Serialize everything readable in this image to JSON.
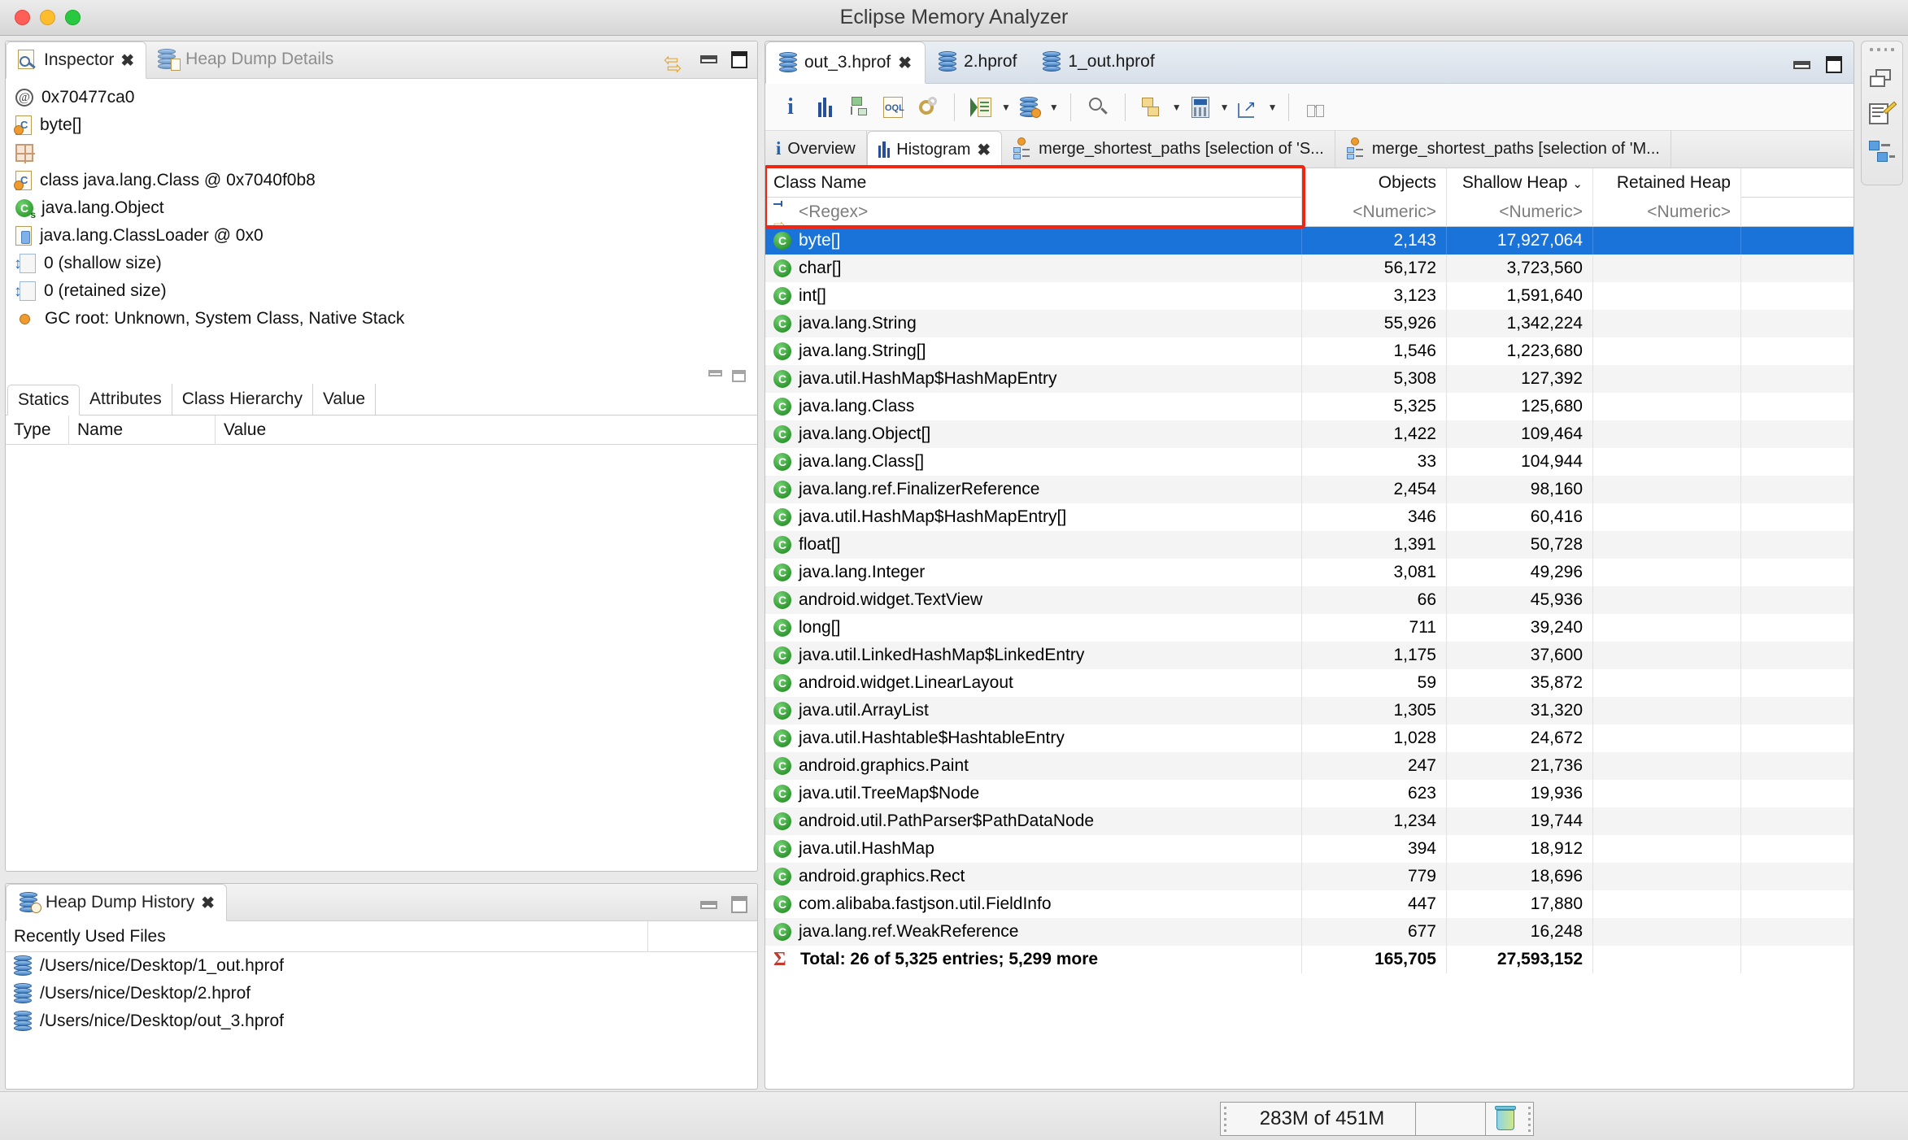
{
  "window": {
    "title": "Eclipse Memory Analyzer",
    "traffic_lights": [
      "close-red",
      "minimize-yellow",
      "zoom-green"
    ]
  },
  "inspector": {
    "tabs": [
      {
        "label": "Inspector",
        "icon": "inspector-icon",
        "active": true,
        "closable": true
      },
      {
        "label": "Heap Dump Details",
        "icon": "heap-dump-details-icon",
        "active": false,
        "closable": false
      }
    ],
    "tools": [
      "link-with-editor-icon",
      "minimize-icon",
      "maximize-icon"
    ],
    "rows": [
      {
        "icon": "address-at-icon",
        "text": "0x70477ca0"
      },
      {
        "icon": "class-doc-icon",
        "text": "byte[]"
      },
      {
        "icon": "grid-icon",
        "text": ""
      },
      {
        "icon": "class-doc-icon",
        "text": "class java.lang.Class @ 0x7040f0b8"
      },
      {
        "icon": "superclass-icon",
        "text": "java.lang.Object"
      },
      {
        "icon": "classloader-icon",
        "text": "java.lang.ClassLoader @ 0x0"
      },
      {
        "icon": "shallow-size-icon",
        "text": "0 (shallow size)"
      },
      {
        "icon": "retained-size-icon",
        "text": "0 (retained size)"
      },
      {
        "icon": "gc-root-icon",
        "text": "GC root: Unknown, System Class, Native Stack"
      }
    ],
    "sub_tabs": [
      {
        "label": "Statics",
        "active": true
      },
      {
        "label": "Attributes",
        "active": false
      },
      {
        "label": "Class Hierarchy",
        "active": false
      },
      {
        "label": "Value",
        "active": false
      }
    ],
    "detail_columns": [
      "Type",
      "Name",
      "Value"
    ],
    "detail_rows": []
  },
  "heap_dump_history": {
    "tab": {
      "label": "Heap Dump History",
      "icon": "heap-dump-history-icon",
      "closable": true
    },
    "tools": [
      "minimize-icon",
      "maximize-icon"
    ],
    "column_header": "Recently Used Files",
    "files": [
      "/Users/nice/Desktop/1_out.hprof",
      "/Users/nice/Desktop/2.hprof",
      "/Users/nice/Desktop/out_3.hprof"
    ]
  },
  "editor": {
    "tabs": [
      {
        "label": "out_3.hprof",
        "active": true,
        "closable": true
      },
      {
        "label": "2.hprof",
        "active": false,
        "closable": false
      },
      {
        "label": "1_out.hprof",
        "active": false,
        "closable": false
      }
    ],
    "tools": [
      "minimize-icon",
      "maximize-icon"
    ],
    "toolbar": [
      {
        "name": "overview-info-icon",
        "glyph": "i"
      },
      {
        "name": "histogram-icon",
        "glyph": "bars"
      },
      {
        "name": "dominator-tree-icon",
        "glyph": "tree"
      },
      {
        "name": "oql-icon",
        "glyph": "OQL"
      },
      {
        "name": "run-expert-system-icon",
        "glyph": "gears"
      },
      {
        "name": "open-query-browser-icon",
        "glyph": "query",
        "dropdown": true
      },
      {
        "name": "inspect-icon",
        "glyph": "inspect",
        "dropdown": true
      },
      {
        "name": "find-icon",
        "glyph": "magnifier"
      },
      {
        "name": "group-by-icon",
        "glyph": "group",
        "dropdown": true
      },
      {
        "name": "calculator-icon",
        "glyph": "calc",
        "dropdown": true
      },
      {
        "name": "export-icon",
        "glyph": "export",
        "dropdown": true
      },
      {
        "name": "compare-icon",
        "glyph": "compare"
      }
    ],
    "inner_tabs": [
      {
        "label": "Overview",
        "icon": "info-icon",
        "active": false,
        "closable": false
      },
      {
        "label": "Histogram",
        "icon": "histogram-icon",
        "active": true,
        "closable": true
      },
      {
        "label": "merge_shortest_paths [selection of 'S...",
        "icon": "paths-icon",
        "active": false,
        "closable": false
      },
      {
        "label": "merge_shortest_paths [selection of 'M...",
        "icon": "paths-icon",
        "active": false,
        "closable": false
      }
    ]
  },
  "histogram": {
    "columns": [
      {
        "label": "Class Name",
        "align": "left"
      },
      {
        "label": "Objects",
        "align": "right"
      },
      {
        "label": "Shallow Heap",
        "align": "right",
        "sorted": "desc",
        "sort_glyph": "⌄"
      },
      {
        "label": "Retained Heap",
        "align": "right"
      }
    ],
    "filter_row": {
      "class_name": "<Regex>",
      "objects": "<Numeric>",
      "shallow_heap": "<Numeric>",
      "retained_heap": "<Numeric>"
    },
    "rows": [
      {
        "class_name": "byte[]",
        "objects": "2,143",
        "shallow_heap": "17,927,064",
        "retained_heap": "",
        "selected": true
      },
      {
        "class_name": "char[]",
        "objects": "56,172",
        "shallow_heap": "3,723,560",
        "retained_heap": ""
      },
      {
        "class_name": "int[]",
        "objects": "3,123",
        "shallow_heap": "1,591,640",
        "retained_heap": ""
      },
      {
        "class_name": "java.lang.String",
        "objects": "55,926",
        "shallow_heap": "1,342,224",
        "retained_heap": ""
      },
      {
        "class_name": "java.lang.String[]",
        "objects": "1,546",
        "shallow_heap": "1,223,680",
        "retained_heap": ""
      },
      {
        "class_name": "java.util.HashMap$HashMapEntry",
        "objects": "5,308",
        "shallow_heap": "127,392",
        "retained_heap": ""
      },
      {
        "class_name": "java.lang.Class",
        "objects": "5,325",
        "shallow_heap": "125,680",
        "retained_heap": ""
      },
      {
        "class_name": "java.lang.Object[]",
        "objects": "1,422",
        "shallow_heap": "109,464",
        "retained_heap": ""
      },
      {
        "class_name": "java.lang.Class[]",
        "objects": "33",
        "shallow_heap": "104,944",
        "retained_heap": ""
      },
      {
        "class_name": "java.lang.ref.FinalizerReference",
        "objects": "2,454",
        "shallow_heap": "98,160",
        "retained_heap": ""
      },
      {
        "class_name": "java.util.HashMap$HashMapEntry[]",
        "objects": "346",
        "shallow_heap": "60,416",
        "retained_heap": ""
      },
      {
        "class_name": "float[]",
        "objects": "1,391",
        "shallow_heap": "50,728",
        "retained_heap": ""
      },
      {
        "class_name": "java.lang.Integer",
        "objects": "3,081",
        "shallow_heap": "49,296",
        "retained_heap": ""
      },
      {
        "class_name": "android.widget.TextView",
        "objects": "66",
        "shallow_heap": "45,936",
        "retained_heap": ""
      },
      {
        "class_name": "long[]",
        "objects": "711",
        "shallow_heap": "39,240",
        "retained_heap": ""
      },
      {
        "class_name": "java.util.LinkedHashMap$LinkedEntry",
        "objects": "1,175",
        "shallow_heap": "37,600",
        "retained_heap": ""
      },
      {
        "class_name": "android.widget.LinearLayout",
        "objects": "59",
        "shallow_heap": "35,872",
        "retained_heap": ""
      },
      {
        "class_name": "java.util.ArrayList",
        "objects": "1,305",
        "shallow_heap": "31,320",
        "retained_heap": ""
      },
      {
        "class_name": "java.util.Hashtable$HashtableEntry",
        "objects": "1,028",
        "shallow_heap": "24,672",
        "retained_heap": ""
      },
      {
        "class_name": "android.graphics.Paint",
        "objects": "247",
        "shallow_heap": "21,736",
        "retained_heap": ""
      },
      {
        "class_name": "java.util.TreeMap$Node",
        "objects": "623",
        "shallow_heap": "19,936",
        "retained_heap": ""
      },
      {
        "class_name": "android.util.PathParser$PathDataNode",
        "objects": "1,234",
        "shallow_heap": "19,744",
        "retained_heap": ""
      },
      {
        "class_name": "java.util.HashMap",
        "objects": "394",
        "shallow_heap": "18,912",
        "retained_heap": ""
      },
      {
        "class_name": "android.graphics.Rect",
        "objects": "779",
        "shallow_heap": "18,696",
        "retained_heap": ""
      },
      {
        "class_name": "com.alibaba.fastjson.util.FieldInfo",
        "objects": "447",
        "shallow_heap": "17,880",
        "retained_heap": ""
      },
      {
        "class_name": "java.lang.ref.WeakReference",
        "objects": "677",
        "shallow_heap": "16,248",
        "retained_heap": ""
      }
    ],
    "total_row": {
      "label": "Total: 26 of 5,325 entries; 5,299 more",
      "objects": "165,705",
      "shallow_heap": "27,593,152",
      "retained_heap": ""
    },
    "highlight": {
      "color": "#f02512",
      "target": "class-name-column-header-and-filter"
    }
  },
  "right_toolbar": {
    "items": [
      {
        "name": "restore-perspective-icon"
      },
      {
        "name": "notes-editor-icon"
      },
      {
        "name": "heap-dump-perspective-icon"
      }
    ]
  },
  "status_bar": {
    "heap_status": "283M of 451M",
    "trash_icon": "run-garbage-collector-icon"
  },
  "colors": {
    "selection_blue": "#1a73d9",
    "highlight_red": "#f02512",
    "class_icon_green": "#168516",
    "accent_orange": "#ef9b2f"
  }
}
